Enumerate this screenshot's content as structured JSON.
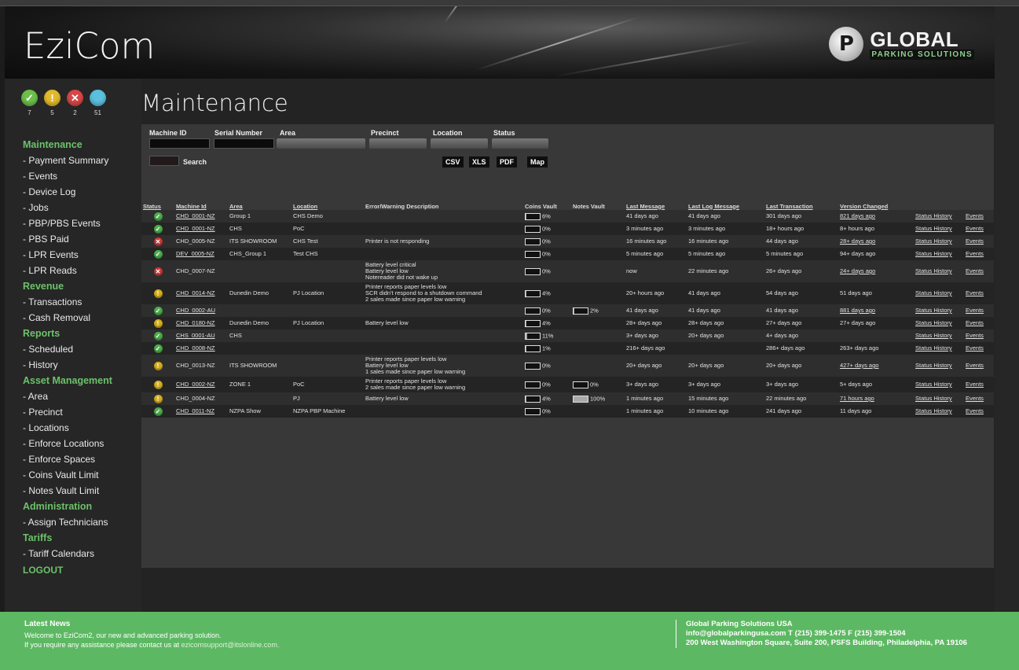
{
  "app": {
    "logo": "EziCom",
    "brand_line1": "GLOBAL",
    "brand_line2": "PARKING SOLUTIONS",
    "brand_mark": "P"
  },
  "status_counts": [
    {
      "kind": "ok",
      "glyph": "✓",
      "count": "7",
      "color": "#6cc04a"
    },
    {
      "kind": "warning",
      "glyph": "!",
      "count": "5",
      "color": "#e2b92c"
    },
    {
      "kind": "error",
      "glyph": "✕",
      "count": "2",
      "color": "#d84747"
    },
    {
      "kind": "info",
      "glyph": "",
      "count": "51",
      "color": "#5bc0de"
    }
  ],
  "nav": [
    {
      "type": "section",
      "label": "Maintenance"
    },
    {
      "type": "item",
      "label": "Payment Summary"
    },
    {
      "type": "item",
      "label": "Events"
    },
    {
      "type": "item",
      "label": "Device Log"
    },
    {
      "type": "item",
      "label": "Jobs"
    },
    {
      "type": "item",
      "label": "PBP/PBS Events"
    },
    {
      "type": "item",
      "label": "PBS Paid"
    },
    {
      "type": "item",
      "label": "LPR Events"
    },
    {
      "type": "item",
      "label": "LPR Reads"
    },
    {
      "type": "section",
      "label": "Revenue"
    },
    {
      "type": "item",
      "label": "Transactions"
    },
    {
      "type": "item",
      "label": "Cash Removal"
    },
    {
      "type": "section",
      "label": "Reports"
    },
    {
      "type": "item",
      "label": "Scheduled"
    },
    {
      "type": "item",
      "label": "History"
    },
    {
      "type": "section",
      "label": "Asset Management"
    },
    {
      "type": "item",
      "label": "Area"
    },
    {
      "type": "item",
      "label": "Precinct"
    },
    {
      "type": "item",
      "label": "Locations"
    },
    {
      "type": "item",
      "label": "Enforce Locations"
    },
    {
      "type": "item",
      "label": "Enforce Spaces"
    },
    {
      "type": "item",
      "label": "Coins Vault Limit"
    },
    {
      "type": "item",
      "label": "Notes Vault Limit"
    },
    {
      "type": "section",
      "label": "Administration"
    },
    {
      "type": "item",
      "label": "Assign Technicians"
    },
    {
      "type": "section",
      "label": "Tariffs"
    },
    {
      "type": "item",
      "label": "Tariff Calendars"
    }
  ],
  "logout_label": "LOGOUT",
  "page_title": "Maintenance",
  "filters": {
    "machine_id": "Machine ID",
    "serial_number": "Serial Number",
    "area": "Area",
    "precinct": "Precinct",
    "location": "Location",
    "status": "Status",
    "search": "Search",
    "csv": "CSV",
    "xls": "XLS",
    "pdf": "PDF",
    "map": "Map"
  },
  "table": {
    "headers": [
      "Status",
      "Machine Id",
      "Area",
      "Location",
      "Error/Warning Description",
      "Coins Vault",
      "Notes Vault",
      "Last Message",
      "Last Log Message",
      "Last Transaction",
      "Version Changed",
      "",
      ""
    ],
    "rows": [
      {
        "status": "ok",
        "id": "CHD_0001-NZ",
        "area": "Group 1",
        "location": "CHS Demo",
        "desc": [],
        "coins": 0.06,
        "coins_label": "6%",
        "notes": null,
        "notes_label": "",
        "last_msg": "41 days ago",
        "last_log": "41 days ago",
        "last_tx": "301 days ago",
        "version": "821 days ago",
        "history": "Status History",
        "events": "Events"
      },
      {
        "status": "ok",
        "id": "CHD_0001-NZ",
        "area": "CHS",
        "location": "PoC",
        "desc": [],
        "coins": 0,
        "coins_label": "0%",
        "notes": null,
        "notes_label": "",
        "last_msg": "3 minutes ago",
        "last_log": "3 minutes ago",
        "last_tx": "18+ hours ago",
        "version": "8+ hours ago",
        "history": "Status History",
        "events": "Events"
      },
      {
        "status": "error",
        "id": "CHD_0005-NZ",
        "area": "ITS SHOWROOM",
        "location": "CHS Test",
        "desc": [
          "Printer is not responding"
        ],
        "coins": 0,
        "coins_label": "0%",
        "notes": null,
        "notes_label": "",
        "last_msg": "16 minutes ago",
        "last_log": "16 minutes ago",
        "last_tx": "44 days ago",
        "version": "28+ days ago",
        "history": "Status History",
        "events": "Events"
      },
      {
        "status": "ok",
        "id": "DEV_0005-NZ",
        "area": "CHS_Group 1",
        "location": "Test CHS",
        "desc": [],
        "coins": 0,
        "coins_label": "0%",
        "notes": null,
        "notes_label": "",
        "last_msg": "5 minutes ago",
        "last_log": "5 minutes ago",
        "last_tx": "5 minutes ago",
        "version": "94+ days ago",
        "history": "Status History",
        "events": "Events"
      },
      {
        "status": "error",
        "id": "CHD_0007-NZ",
        "area": "",
        "location": "",
        "desc": [
          "Battery level critical",
          "Battery level low",
          "Notereader did not wake up"
        ],
        "coins": 0,
        "coins_label": "0%",
        "notes": null,
        "notes_label": "",
        "last_msg": "now",
        "last_log": "22 minutes ago",
        "last_tx": "26+ days ago",
        "version": "24+ days ago",
        "history": "Status History",
        "events": "Events"
      },
      {
        "status": "warning",
        "id": "CHD_0014-NZ",
        "area": "Dunedin Demo",
        "location": "PJ Location",
        "desc": [
          "Printer reports paper levels low",
          "SCR didn't respond to a shutdown command",
          "2 sales made since paper low warning"
        ],
        "coins": 0.04,
        "coins_label": "4%",
        "notes": null,
        "notes_label": "",
        "last_msg": "20+ hours ago",
        "last_log": "41 days ago",
        "last_tx": "54 days ago",
        "version": "51 days ago",
        "history": "Status History",
        "events": "Events"
      },
      {
        "status": "ok",
        "id": "CHD_0002-AU",
        "area": "",
        "location": "",
        "desc": [],
        "coins": 0,
        "coins_label": "0%",
        "notes": 0.02,
        "notes_label": "2%",
        "last_msg": "41 days ago",
        "last_log": "41 days ago",
        "last_tx": "41 days ago",
        "version": "881 days ago",
        "history": "Status History",
        "events": "Events"
      },
      {
        "status": "warning",
        "id": "CHD_0180-NZ",
        "area": "Dunedin Demo",
        "location": "PJ Location",
        "desc": [
          "Battery level low"
        ],
        "coins": 0.04,
        "coins_label": "4%",
        "notes": null,
        "notes_label": "",
        "last_msg": "28+ days ago",
        "last_log": "28+ days ago",
        "last_tx": "27+ days ago",
        "version": "27+ days ago",
        "history": "Status History",
        "events": "Events"
      },
      {
        "status": "ok",
        "id": "CHS_0001-AU",
        "area": "CHS",
        "location": "",
        "desc": [],
        "coins": 0.11,
        "coins_label": "11%",
        "notes": null,
        "notes_label": "",
        "last_msg": "3+ days ago",
        "last_log": "20+ days ago",
        "last_tx": "4+ days ago",
        "version": "",
        "history": "Status History",
        "events": "Events"
      },
      {
        "status": "ok",
        "id": "CHD_0008-NZ",
        "area": "",
        "location": "",
        "desc": [],
        "coins": 0.01,
        "coins_label": "1%",
        "notes": null,
        "notes_label": "",
        "last_msg": "216+ days ago",
        "last_log": "",
        "last_tx": "286+ days ago",
        "version": "263+ days ago",
        "history": "Status History",
        "events": "Events"
      },
      {
        "status": "warning",
        "id": "CHD_0013-NZ",
        "area": "ITS SHOWROOM",
        "location": "",
        "desc": [
          "Printer reports paper levels low",
          "Battery level low",
          "1 sales made since paper low warning"
        ],
        "coins": 0,
        "coins_label": "0%",
        "notes": null,
        "notes_label": "",
        "last_msg": "20+ days ago",
        "last_log": "20+ days ago",
        "last_tx": "20+ days ago",
        "version": "427+ days ago",
        "history": "Status History",
        "events": "Events"
      },
      {
        "status": "warning",
        "id": "CHD_0002-NZ",
        "area": "ZONE 1",
        "location": "PoC",
        "desc": [
          "Printer reports paper levels low",
          "2 sales made since paper low warning"
        ],
        "coins": 0,
        "coins_label": "0%",
        "notes": 0,
        "notes_label": "0%",
        "last_msg": "3+ days ago",
        "last_log": "3+ days ago",
        "last_tx": "3+ days ago",
        "version": "5+ days ago",
        "history": "Status History",
        "events": "Events"
      },
      {
        "status": "warning",
        "id": "CHD_0004-NZ",
        "area": "",
        "location": "PJ",
        "desc": [
          "Battery level low"
        ],
        "coins": 0.04,
        "coins_label": "4%",
        "notes": 1.0,
        "notes_label": "100%",
        "last_msg": "1 minutes ago",
        "last_log": "15 minutes ago",
        "last_tx": "22 minutes ago",
        "version": "71 hours ago",
        "history": "Status History",
        "events": "Events"
      },
      {
        "status": "ok",
        "id": "CHD_0011-NZ",
        "area": "NZPA Show",
        "location": "NZPA PBP Machine",
        "desc": [],
        "coins": 0,
        "coins_label": "0%",
        "notes": null,
        "notes_label": "",
        "last_msg": "1 minutes ago",
        "last_log": "10 minutes ago",
        "last_tx": "241 days ago",
        "version": "11 days ago",
        "history": "Status History",
        "events": "Events"
      }
    ]
  },
  "footer": {
    "news_title": "Latest News",
    "news_line1": "Welcome to EziCom2, our new and advanced parking solution.",
    "news_line2": "If you require any assistance please contact us at ",
    "news_email": "ezicomsupport@itslonline.com",
    "news_end": ".",
    "company": "Global Parking Solutions USA",
    "contact": "info@globalparkingusa.com  T (215) 399-1475  F (215) 399-1504",
    "address": "200 West Washington Square, Suite 200, PSFS Building, Philadelphia, PA 19106"
  }
}
